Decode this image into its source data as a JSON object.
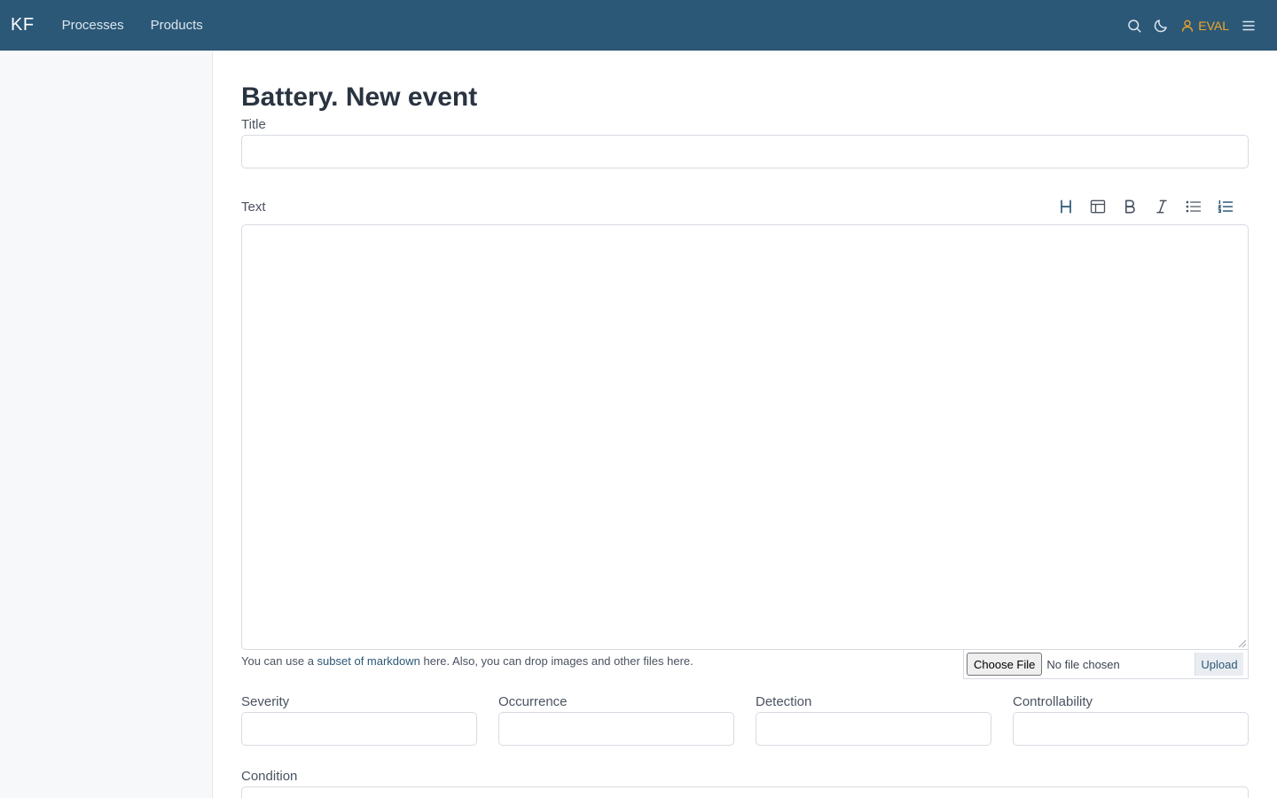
{
  "navbar": {
    "brand": "KF",
    "links": [
      "Processes",
      "Products"
    ],
    "user_label": "EVAL",
    "icons": [
      "search-icon",
      "moon-icon",
      "user-icon",
      "menu-icon"
    ],
    "background": "#2c5878",
    "accent": "#f5a623"
  },
  "page": {
    "title": "Battery. New event"
  },
  "form": {
    "title_label": "Title",
    "title_value": "",
    "text_label": "Text",
    "text_value": "",
    "toolbar": [
      "heading-icon",
      "table-icon",
      "bold-icon",
      "italic-icon",
      "bullet-list-icon",
      "numbered-list-icon"
    ],
    "hint_prefix": "You can use a ",
    "hint_link": "subset of markdown",
    "hint_suffix": " here. Also, you can drop images and other files here.",
    "choose_file_label": "Choose File",
    "no_file_label": "No file chosen",
    "upload_label": "Upload",
    "severity_label": "Severity",
    "occurrence_label": "Occurrence",
    "detection_label": "Detection",
    "controllability_label": "Controllability",
    "condition_label": "Condition"
  }
}
